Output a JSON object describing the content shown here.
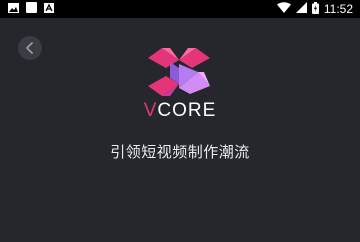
{
  "status_bar": {
    "time": "11:52",
    "left_icons": [
      "image-icon",
      "square-icon",
      "app-a-icon"
    ],
    "right_icons": [
      "wifi-icon",
      "signal-icon",
      "battery-icon"
    ]
  },
  "back_button": {
    "icon": "chevron-left-icon"
  },
  "brand": {
    "first_letter": "V",
    "rest": "CORE"
  },
  "slogan": "引领短视频制作潮流",
  "colors": {
    "background": "#25272d",
    "accent_pink": "#e4357a",
    "accent_violet": "#b37cf0"
  }
}
